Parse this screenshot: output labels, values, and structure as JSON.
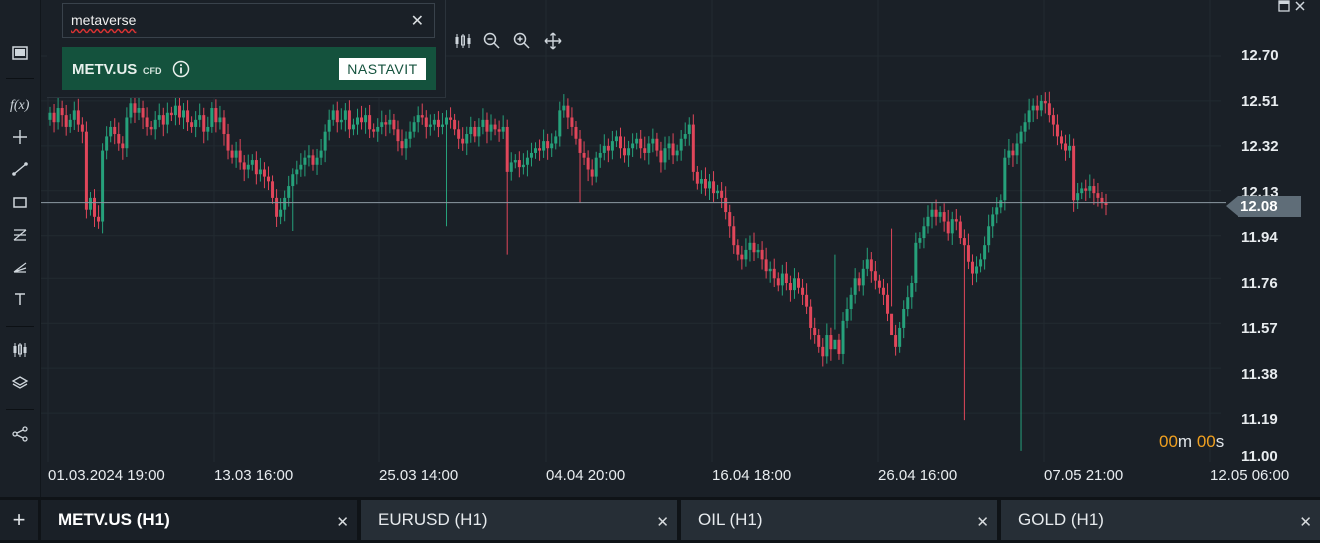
{
  "search": {
    "query": "metaverse"
  },
  "result": {
    "symbol": "METV.US",
    "badge": "CFD",
    "action_label": "NASTAVIT"
  },
  "price_axis": [
    "12.70",
    "12.51",
    "12.32",
    "12.13",
    "11.94",
    "11.76",
    "11.57",
    "11.38",
    "11.19",
    "11.00"
  ],
  "time_axis": [
    "01.03.2024 19:00",
    "13.03 16:00",
    "25.03 14:00",
    "04.04 20:00",
    "16.04 18:00",
    "26.04 16:00",
    "07.05 21:00",
    "12.05 06:00"
  ],
  "current_price": "12.08",
  "timer": {
    "minutes": "00",
    "m": "m",
    "seconds": "00",
    "s": "s"
  },
  "tabs": [
    {
      "label": "METV.US (H1)"
    },
    {
      "label": "EURUSD (H1)"
    },
    {
      "label": "OIL (H1)"
    },
    {
      "label": "GOLD (H1)"
    }
  ],
  "colors": {
    "up": "#26a17b",
    "down": "#e0465a",
    "background": "#1a2027",
    "accent_green": "#14523d",
    "timer": "#f0a020"
  },
  "chart_data": {
    "type": "candlestick",
    "y_min": 11.0,
    "y_max": 12.7,
    "current": 12.08,
    "closes": [
      12.46,
      12.42,
      12.48,
      12.45,
      12.4,
      12.43,
      12.47,
      12.41,
      12.38,
      12.05,
      12.1,
      12.02,
      12.0,
      12.3,
      12.36,
      12.4,
      12.37,
      12.33,
      12.31,
      12.44,
      12.5,
      12.46,
      12.48,
      12.44,
      12.4,
      12.39,
      12.43,
      12.45,
      12.41,
      12.46,
      12.45,
      12.49,
      12.44,
      12.47,
      12.42,
      12.4,
      12.43,
      12.45,
      12.38,
      12.4,
      12.48,
      12.42,
      12.44,
      12.37,
      12.3,
      12.27,
      12.3,
      12.25,
      12.22,
      12.24,
      12.26,
      12.2,
      12.22,
      12.19,
      12.17,
      12.1,
      12.02,
      12.05,
      12.1,
      12.15,
      12.2,
      12.22,
      12.24,
      12.27,
      12.28,
      12.24,
      12.27,
      12.3,
      12.38,
      12.43,
      12.47,
      12.42,
      12.43,
      12.47,
      12.39,
      12.41,
      12.44,
      12.42,
      12.45,
      12.39,
      12.38,
      12.4,
      12.42,
      12.41,
      12.43,
      12.39,
      12.34,
      12.31,
      12.35,
      12.38,
      12.42,
      12.45,
      12.44,
      12.4,
      12.41,
      12.43,
      12.4,
      12.41,
      12.44,
      12.43,
      12.39,
      12.35,
      12.33,
      12.37,
      12.4,
      12.36,
      12.4,
      12.43,
      12.38,
      12.41,
      12.39,
      12.38,
      12.4,
      12.21,
      12.25,
      12.26,
      12.23,
      12.24,
      12.27,
      12.29,
      12.31,
      12.3,
      12.34,
      12.31,
      12.33,
      12.36,
      12.47,
      12.49,
      12.44,
      12.4,
      12.35,
      12.29,
      12.27,
      12.22,
      12.19,
      12.27,
      12.29,
      12.32,
      12.3,
      12.34,
      12.36,
      12.31,
      12.28,
      12.31,
      12.33,
      12.35,
      12.31,
      12.29,
      12.33,
      12.35,
      12.3,
      12.25,
      12.31,
      12.33,
      12.28,
      12.3,
      12.35,
      12.37,
      12.41,
      12.21,
      12.16,
      12.18,
      12.14,
      12.17,
      12.12,
      12.13,
      12.1,
      12.04,
      11.98,
      11.9,
      11.86,
      11.84,
      11.88,
      11.91,
      11.87,
      11.88,
      11.84,
      11.79,
      11.8,
      11.76,
      11.73,
      11.78,
      11.74,
      11.71,
      11.76,
      11.72,
      11.69,
      11.64,
      11.55,
      11.52,
      11.47,
      11.43,
      11.52,
      11.46,
      11.5,
      11.44,
      11.58,
      11.63,
      11.69,
      11.76,
      11.73,
      11.8,
      11.84,
      11.79,
      11.75,
      11.72,
      11.69,
      11.61,
      11.52,
      11.47,
      11.55,
      11.63,
      11.68,
      11.74,
      11.91,
      11.93,
      11.98,
      12.02,
      12.05,
      12.02,
      12.04,
      12.0,
      11.95,
      12.01,
      12.0,
      11.93,
      11.9,
      11.83,
      11.78,
      11.81,
      11.84,
      11.9,
      11.98,
      12.03,
      12.06,
      12.09,
      12.27,
      12.3,
      12.28,
      12.33,
      12.38,
      12.42,
      12.47,
      12.49,
      12.47,
      12.51,
      12.5,
      12.45,
      12.41,
      12.36,
      12.33,
      12.3,
      12.32,
      12.09,
      12.12,
      12.14,
      12.13,
      12.15,
      12.12,
      12.1,
      12.08,
      12.07
    ],
    "long_wicks": [
      [
        13,
        11.95
      ],
      [
        60,
        11.96
      ],
      [
        98,
        11.98
      ],
      [
        113,
        11.86
      ],
      [
        131,
        12.08
      ],
      [
        194,
        11.86
      ],
      [
        208,
        11.97
      ],
      [
        226,
        11.16
      ],
      [
        240,
        11.03
      ]
    ]
  }
}
